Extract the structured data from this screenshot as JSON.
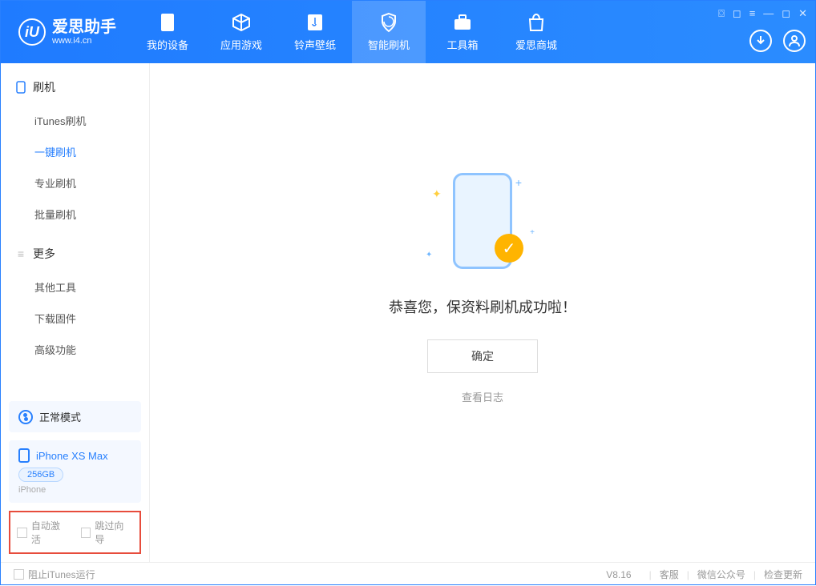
{
  "app": {
    "logo_title": "爱思助手",
    "logo_sub": "www.i4.cn"
  },
  "nav": {
    "items": [
      {
        "label": "我的设备",
        "icon": "device"
      },
      {
        "label": "应用游戏",
        "icon": "cube"
      },
      {
        "label": "铃声壁纸",
        "icon": "music"
      },
      {
        "label": "智能刷机",
        "icon": "shield",
        "active": true
      },
      {
        "label": "工具箱",
        "icon": "toolbox"
      },
      {
        "label": "爱思商城",
        "icon": "store"
      }
    ]
  },
  "sidebar": {
    "section1_title": "刷机",
    "section1_items": [
      "iTunes刷机",
      "一键刷机",
      "专业刷机",
      "批量刷机"
    ],
    "section1_active_index": 1,
    "section2_title": "更多",
    "section2_items": [
      "其他工具",
      "下载固件",
      "高级功能"
    ],
    "mode_label": "正常模式",
    "device": {
      "name": "iPhone XS Max",
      "storage": "256GB",
      "type": "iPhone"
    },
    "options": {
      "auto_activate": "自动激活",
      "skip_guide": "跳过向导"
    }
  },
  "main": {
    "success_text": "恭喜您，保资料刷机成功啦！",
    "ok_button": "确定",
    "view_log": "查看日志"
  },
  "footer": {
    "block_itunes": "阻止iTunes运行",
    "version": "V8.16",
    "customer_service": "客服",
    "wechat": "微信公众号",
    "check_update": "检查更新"
  }
}
